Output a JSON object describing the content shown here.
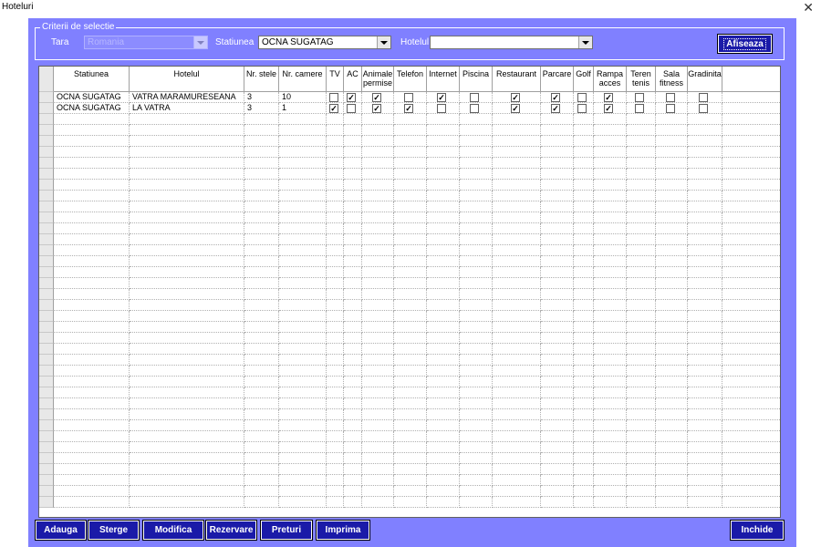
{
  "window": {
    "title": "Hoteluri",
    "close_glyph": "✕"
  },
  "criteria": {
    "legend": "Criterii de selectie",
    "country_label": "Tara",
    "country_value": "Romania",
    "resort_label": "Statiunea",
    "resort_value": "OCNA SUGATAG",
    "hotel_label": "Hotelul",
    "hotel_value": "",
    "show_button": "Afiseaza"
  },
  "table": {
    "columns": [
      "Statiunea",
      "Hotelul",
      "Nr. stele",
      "Nr. camere",
      "TV",
      "AC",
      "Animale permise",
      "Telefon",
      "Internet",
      "Piscina",
      "Restaurant",
      "Parcare",
      "Golf",
      "Rampa acces",
      "Teren tenis",
      "Sala fitness",
      "Gradinita"
    ],
    "rows": [
      {
        "statiunea": "OCNA SUGATAG",
        "hotelul": "VATRA MARAMURESEANA",
        "stele": "3",
        "camere": "10",
        "flags": [
          false,
          true,
          true,
          false,
          true,
          false,
          true,
          true,
          false,
          true,
          false,
          false,
          false
        ]
      },
      {
        "statiunea": "OCNA SUGATAG",
        "hotelul": "LA VATRA",
        "stele": "3",
        "camere": "1",
        "flags": [
          true,
          false,
          true,
          true,
          false,
          false,
          true,
          true,
          false,
          true,
          false,
          false,
          false
        ]
      }
    ]
  },
  "buttons": {
    "add": "Adauga",
    "delete": "Sterge",
    "modify": "Modifica",
    "reserve": "Rezervare",
    "prices": "Preturi",
    "print": "Imprima",
    "close": "Inchide"
  },
  "colors": {
    "panel": "#8080ff",
    "button": "#1a1aa8"
  }
}
